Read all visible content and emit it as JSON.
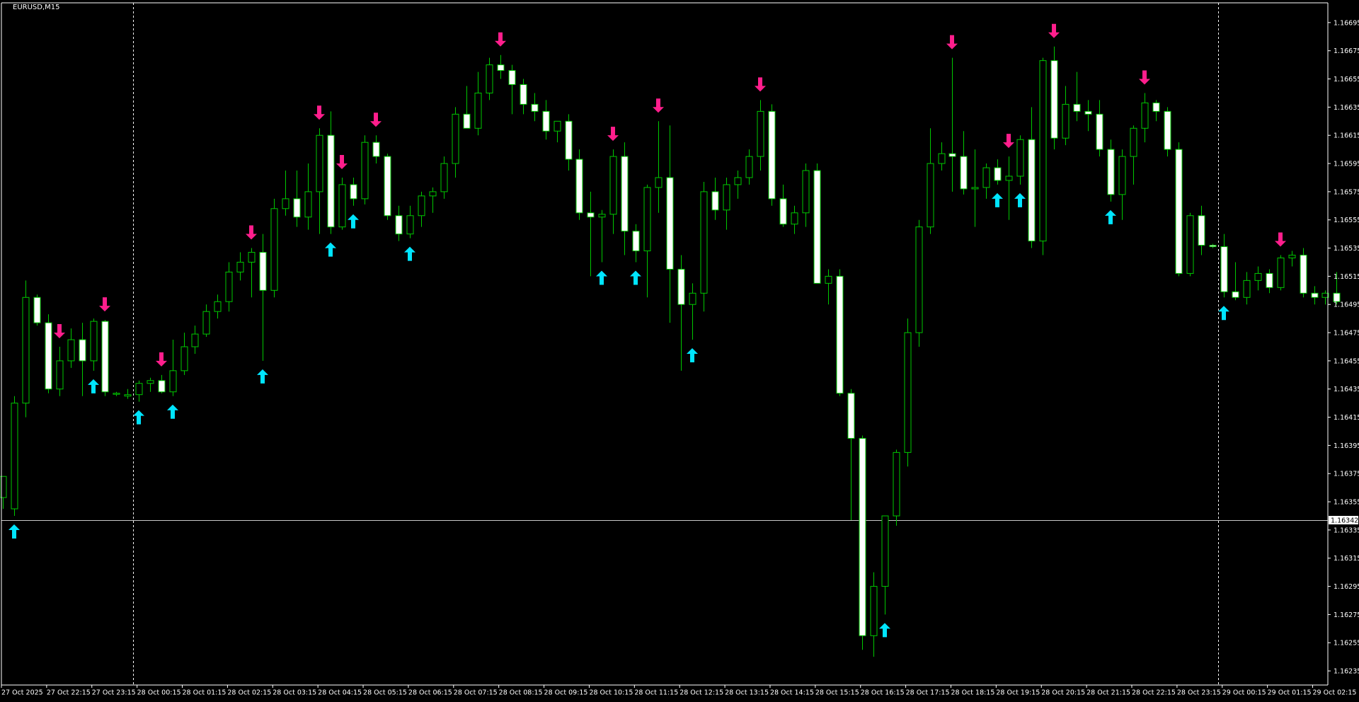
{
  "chart_data": {
    "type": "candlestick",
    "title": "EURUSD,M15",
    "ylim": [
      1.16225,
      1.16709
    ],
    "current_price": 1.16342,
    "current_price_label": "1.16342",
    "y_ticks": [
      "1.16695",
      "1.16675",
      "1.16655",
      "1.16635",
      "1.16615",
      "1.16595",
      "1.16575",
      "1.16555",
      "1.16535",
      "1.16515",
      "1.16495",
      "1.16475",
      "1.16455",
      "1.16435",
      "1.16415",
      "1.16395",
      "1.16375",
      "1.16355",
      "1.16335",
      "1.16315",
      "1.16295",
      "1.16275",
      "1.16255",
      "1.16235"
    ],
    "x_ticks": [
      {
        "label": "27 Oct 2025",
        "bar": 0
      },
      {
        "label": "27 Oct 22:15",
        "bar": 4
      },
      {
        "label": "27 Oct 23:15",
        "bar": 8
      },
      {
        "label": "28 Oct 00:15",
        "bar": 12
      },
      {
        "label": "28 Oct 01:15",
        "bar": 16
      },
      {
        "label": "28 Oct 02:15",
        "bar": 20
      },
      {
        "label": "28 Oct 03:15",
        "bar": 24
      },
      {
        "label": "28 Oct 04:15",
        "bar": 28
      },
      {
        "label": "28 Oct 05:15",
        "bar": 32
      },
      {
        "label": "28 Oct 06:15",
        "bar": 36
      },
      {
        "label": "28 Oct 07:15",
        "bar": 40
      },
      {
        "label": "28 Oct 08:15",
        "bar": 44
      },
      {
        "label": "28 Oct 09:15",
        "bar": 48
      },
      {
        "label": "28 Oct 10:15",
        "bar": 52
      },
      {
        "label": "28 Oct 11:15",
        "bar": 56
      },
      {
        "label": "28 Oct 12:15",
        "bar": 60
      },
      {
        "label": "28 Oct 13:15",
        "bar": 64
      },
      {
        "label": "28 Oct 14:15",
        "bar": 68
      },
      {
        "label": "28 Oct 15:15",
        "bar": 72
      },
      {
        "label": "28 Oct 16:15",
        "bar": 76
      },
      {
        "label": "28 Oct 17:15",
        "bar": 80
      },
      {
        "label": "28 Oct 18:15",
        "bar": 84
      },
      {
        "label": "28 Oct 19:15",
        "bar": 88
      },
      {
        "label": "28 Oct 20:15",
        "bar": 92
      },
      {
        "label": "28 Oct 21:15",
        "bar": 96
      },
      {
        "label": "28 Oct 22:15",
        "bar": 100
      },
      {
        "label": "28 Oct 23:15",
        "bar": 104
      },
      {
        "label": "29 Oct 00:15",
        "bar": 108
      },
      {
        "label": "29 Oct 01:15",
        "bar": 112
      },
      {
        "label": "29 Oct 02:15",
        "bar": 116
      }
    ],
    "day_separators": [
      11,
      107
    ],
    "candles": [
      {
        "o": 1.16358,
        "h": 1.1637,
        "l": 1.1635,
        "c": 1.16373
      },
      {
        "o": 1.1635,
        "h": 1.1643,
        "l": 1.16345,
        "c": 1.16425
      },
      {
        "o": 1.16425,
        "h": 1.16512,
        "l": 1.16415,
        "c": 1.165
      },
      {
        "o": 1.165,
        "h": 1.16502,
        "l": 1.1648,
        "c": 1.16482
      },
      {
        "o": 1.16482,
        "h": 1.16488,
        "l": 1.16432,
        "c": 1.16435
      },
      {
        "o": 1.16435,
        "h": 1.16465,
        "l": 1.1643,
        "c": 1.16455
      },
      {
        "o": 1.16455,
        "h": 1.16478,
        "l": 1.1645,
        "c": 1.1647
      },
      {
        "o": 1.1647,
        "h": 1.16482,
        "l": 1.1643,
        "c": 1.16455
      },
      {
        "o": 1.16455,
        "h": 1.16485,
        "l": 1.16448,
        "c": 1.16483
      },
      {
        "o": 1.16483,
        "h": 1.16484,
        "l": 1.1643,
        "c": 1.16433
      },
      {
        "o": 1.16432,
        "h": 1.16433,
        "l": 1.1643,
        "c": 1.16432
      },
      {
        "o": 1.1643,
        "h": 1.16435,
        "l": 1.16428,
        "c": 1.16431
      },
      {
        "o": 1.16431,
        "h": 1.16441,
        "l": 1.16426,
        "c": 1.16439
      },
      {
        "o": 1.16439,
        "h": 1.16443,
        "l": 1.16433,
        "c": 1.16441
      },
      {
        "o": 1.16441,
        "h": 1.16445,
        "l": 1.16432,
        "c": 1.16433
      },
      {
        "o": 1.16433,
        "h": 1.1647,
        "l": 1.1643,
        "c": 1.16448
      },
      {
        "o": 1.16448,
        "h": 1.16475,
        "l": 1.16445,
        "c": 1.16465
      },
      {
        "o": 1.16465,
        "h": 1.1648,
        "l": 1.1646,
        "c": 1.16474
      },
      {
        "o": 1.16474,
        "h": 1.16495,
        "l": 1.16472,
        "c": 1.1649
      },
      {
        "o": 1.1649,
        "h": 1.16502,
        "l": 1.16485,
        "c": 1.16497
      },
      {
        "o": 1.16497,
        "h": 1.16525,
        "l": 1.1649,
        "c": 1.16518
      },
      {
        "o": 1.16518,
        "h": 1.16532,
        "l": 1.16512,
        "c": 1.16525
      },
      {
        "o": 1.16525,
        "h": 1.16535,
        "l": 1.165,
        "c": 1.16532
      },
      {
        "o": 1.16532,
        "h": 1.16545,
        "l": 1.16455,
        "c": 1.16505
      },
      {
        "o": 1.16505,
        "h": 1.1657,
        "l": 1.165,
        "c": 1.16563
      },
      {
        "o": 1.16563,
        "h": 1.1659,
        "l": 1.16558,
        "c": 1.1657
      },
      {
        "o": 1.1657,
        "h": 1.1659,
        "l": 1.1655,
        "c": 1.16557
      },
      {
        "o": 1.16557,
        "h": 1.16595,
        "l": 1.16548,
        "c": 1.16575
      },
      {
        "o": 1.16575,
        "h": 1.1662,
        "l": 1.16545,
        "c": 1.16615
      },
      {
        "o": 1.16615,
        "h": 1.16632,
        "l": 1.16545,
        "c": 1.1655
      },
      {
        "o": 1.1655,
        "h": 1.16585,
        "l": 1.16548,
        "c": 1.1658
      },
      {
        "o": 1.1658,
        "h": 1.16585,
        "l": 1.16565,
        "c": 1.1657
      },
      {
        "o": 1.1657,
        "h": 1.16615,
        "l": 1.16566,
        "c": 1.1661
      },
      {
        "o": 1.1661,
        "h": 1.16615,
        "l": 1.16595,
        "c": 1.166
      },
      {
        "o": 1.166,
        "h": 1.16602,
        "l": 1.16555,
        "c": 1.16558
      },
      {
        "o": 1.16558,
        "h": 1.16565,
        "l": 1.1654,
        "c": 1.16545
      },
      {
        "o": 1.16545,
        "h": 1.16565,
        "l": 1.16542,
        "c": 1.16558
      },
      {
        "o": 1.16558,
        "h": 1.16575,
        "l": 1.1655,
        "c": 1.16572
      },
      {
        "o": 1.16572,
        "h": 1.16578,
        "l": 1.1656,
        "c": 1.16575
      },
      {
        "o": 1.16575,
        "h": 1.166,
        "l": 1.1657,
        "c": 1.16595
      },
      {
        "o": 1.16595,
        "h": 1.16635,
        "l": 1.16585,
        "c": 1.1663
      },
      {
        "o": 1.1663,
        "h": 1.1665,
        "l": 1.1662,
        "c": 1.1662
      },
      {
        "o": 1.1662,
        "h": 1.1666,
        "l": 1.16615,
        "c": 1.16645
      },
      {
        "o": 1.16645,
        "h": 1.1667,
        "l": 1.1664,
        "c": 1.16665
      },
      {
        "o": 1.16665,
        "h": 1.16672,
        "l": 1.16655,
        "c": 1.16661
      },
      {
        "o": 1.16661,
        "h": 1.16665,
        "l": 1.1663,
        "c": 1.16651
      },
      {
        "o": 1.16651,
        "h": 1.16655,
        "l": 1.1663,
        "c": 1.16637
      },
      {
        "o": 1.16637,
        "h": 1.16645,
        "l": 1.16625,
        "c": 1.16632
      },
      {
        "o": 1.16632,
        "h": 1.1664,
        "l": 1.16612,
        "c": 1.16618
      },
      {
        "o": 1.16618,
        "h": 1.16625,
        "l": 1.1661,
        "c": 1.16625
      },
      {
        "o": 1.16625,
        "h": 1.1663,
        "l": 1.1659,
        "c": 1.16598
      },
      {
        "o": 1.16598,
        "h": 1.16605,
        "l": 1.16555,
        "c": 1.1656
      },
      {
        "o": 1.1656,
        "h": 1.16575,
        "l": 1.16515,
        "c": 1.16557
      },
      {
        "o": 1.16557,
        "h": 1.16562,
        "l": 1.16525,
        "c": 1.16559
      },
      {
        "o": 1.16559,
        "h": 1.16605,
        "l": 1.16545,
        "c": 1.166
      },
      {
        "o": 1.166,
        "h": 1.1661,
        "l": 1.1653,
        "c": 1.16547
      },
      {
        "o": 1.16547,
        "h": 1.16552,
        "l": 1.16525,
        "c": 1.16533
      },
      {
        "o": 1.16533,
        "h": 1.1658,
        "l": 1.165,
        "c": 1.16578
      },
      {
        "o": 1.16578,
        "h": 1.16625,
        "l": 1.1656,
        "c": 1.16585
      },
      {
        "o": 1.16585,
        "h": 1.16622,
        "l": 1.16482,
        "c": 1.1652
      },
      {
        "o": 1.1652,
        "h": 1.1653,
        "l": 1.16448,
        "c": 1.16495
      },
      {
        "o": 1.16495,
        "h": 1.1651,
        "l": 1.1647,
        "c": 1.16503
      },
      {
        "o": 1.16503,
        "h": 1.16582,
        "l": 1.1649,
        "c": 1.16575
      },
      {
        "o": 1.16575,
        "h": 1.16585,
        "l": 1.16555,
        "c": 1.16562
      },
      {
        "o": 1.16562,
        "h": 1.16585,
        "l": 1.16548,
        "c": 1.1658
      },
      {
        "o": 1.1658,
        "h": 1.1659,
        "l": 1.1657,
        "c": 1.16585
      },
      {
        "o": 1.16585,
        "h": 1.16605,
        "l": 1.1658,
        "c": 1.166
      },
      {
        "o": 1.166,
        "h": 1.1664,
        "l": 1.1659,
        "c": 1.16632
      },
      {
        "o": 1.16632,
        "h": 1.16637,
        "l": 1.16565,
        "c": 1.1657
      },
      {
        "o": 1.1657,
        "h": 1.1658,
        "l": 1.1655,
        "c": 1.16552
      },
      {
        "o": 1.16552,
        "h": 1.16565,
        "l": 1.16545,
        "c": 1.1656
      },
      {
        "o": 1.1656,
        "h": 1.16595,
        "l": 1.1655,
        "c": 1.1659
      },
      {
        "o": 1.1659,
        "h": 1.16595,
        "l": 1.1651,
        "c": 1.1651
      },
      {
        "o": 1.1651,
        "h": 1.1652,
        "l": 1.16495,
        "c": 1.16515
      },
      {
        "o": 1.16515,
        "h": 1.1652,
        "l": 1.1643,
        "c": 1.16432
      },
      {
        "o": 1.16432,
        "h": 1.16435,
        "l": 1.16342,
        "c": 1.164
      },
      {
        "o": 1.164,
        "h": 1.16402,
        "l": 1.1625,
        "c": 1.1626
      },
      {
        "o": 1.1626,
        "h": 1.16305,
        "l": 1.16245,
        "c": 1.16295
      },
      {
        "o": 1.16295,
        "h": 1.16345,
        "l": 1.16275,
        "c": 1.16345
      },
      {
        "o": 1.16345,
        "h": 1.16392,
        "l": 1.16338,
        "c": 1.1639
      },
      {
        "o": 1.1639,
        "h": 1.16485,
        "l": 1.1638,
        "c": 1.16475
      },
      {
        "o": 1.16475,
        "h": 1.16555,
        "l": 1.16465,
        "c": 1.1655
      },
      {
        "o": 1.1655,
        "h": 1.1662,
        "l": 1.16545,
        "c": 1.16595
      },
      {
        "o": 1.16595,
        "h": 1.1661,
        "l": 1.1659,
        "c": 1.16602
      },
      {
        "o": 1.16602,
        "h": 1.1667,
        "l": 1.16575,
        "c": 1.166
      },
      {
        "o": 1.166,
        "h": 1.16618,
        "l": 1.16573,
        "c": 1.16577
      },
      {
        "o": 1.16577,
        "h": 1.16605,
        "l": 1.1655,
        "c": 1.16578
      },
      {
        "o": 1.16578,
        "h": 1.16595,
        "l": 1.1657,
        "c": 1.16592
      },
      {
        "o": 1.16592,
        "h": 1.16598,
        "l": 1.1658,
        "c": 1.16583
      },
      {
        "o": 1.16583,
        "h": 1.166,
        "l": 1.16555,
        "c": 1.16586
      },
      {
        "o": 1.16586,
        "h": 1.16615,
        "l": 1.1658,
        "c": 1.16612
      },
      {
        "o": 1.16612,
        "h": 1.16635,
        "l": 1.16535,
        "c": 1.1654
      },
      {
        "o": 1.1654,
        "h": 1.1667,
        "l": 1.1653,
        "c": 1.16668
      },
      {
        "o": 1.16668,
        "h": 1.16678,
        "l": 1.16605,
        "c": 1.16613
      },
      {
        "o": 1.16613,
        "h": 1.1665,
        "l": 1.16608,
        "c": 1.16637
      },
      {
        "o": 1.16637,
        "h": 1.1666,
        "l": 1.16625,
        "c": 1.16632
      },
      {
        "o": 1.16632,
        "h": 1.1664,
        "l": 1.16618,
        "c": 1.1663
      },
      {
        "o": 1.1663,
        "h": 1.1664,
        "l": 1.166,
        "c": 1.16605
      },
      {
        "o": 1.16605,
        "h": 1.16612,
        "l": 1.16568,
        "c": 1.16573
      },
      {
        "o": 1.16573,
        "h": 1.16605,
        "l": 1.16555,
        "c": 1.166
      },
      {
        "o": 1.166,
        "h": 1.16622,
        "l": 1.1658,
        "c": 1.1662
      },
      {
        "o": 1.1662,
        "h": 1.16645,
        "l": 1.1661,
        "c": 1.16638
      },
      {
        "o": 1.16638,
        "h": 1.1664,
        "l": 1.16625,
        "c": 1.16632
      },
      {
        "o": 1.16632,
        "h": 1.16635,
        "l": 1.166,
        "c": 1.16605
      },
      {
        "o": 1.16605,
        "h": 1.1661,
        "l": 1.16515,
        "c": 1.16517
      },
      {
        "o": 1.16517,
        "h": 1.1656,
        "l": 1.16515,
        "c": 1.16558
      },
      {
        "o": 1.16558,
        "h": 1.16565,
        "l": 1.1653,
        "c": 1.16537
      },
      {
        "o": 1.16537,
        "h": 1.16538,
        "l": 1.16535,
        "c": 1.16536
      },
      {
        "o": 1.16536,
        "h": 1.16545,
        "l": 1.165,
        "c": 1.16504
      },
      {
        "o": 1.16504,
        "h": 1.16525,
        "l": 1.16498,
        "c": 1.165
      },
      {
        "o": 1.165,
        "h": 1.16518,
        "l": 1.16495,
        "c": 1.16512
      },
      {
        "o": 1.16512,
        "h": 1.16522,
        "l": 1.16505,
        "c": 1.16517
      },
      {
        "o": 1.16517,
        "h": 1.1652,
        "l": 1.16503,
        "c": 1.16507
      },
      {
        "o": 1.16507,
        "h": 1.1653,
        "l": 1.16505,
        "c": 1.16528
      },
      {
        "o": 1.16528,
        "h": 1.16533,
        "l": 1.16522,
        "c": 1.1653
      },
      {
        "o": 1.1653,
        "h": 1.16535,
        "l": 1.165,
        "c": 1.16503
      },
      {
        "o": 1.16503,
        "h": 1.16508,
        "l": 1.16495,
        "c": 1.165
      },
      {
        "o": 1.165,
        "h": 1.16505,
        "l": 1.16495,
        "c": 1.16503
      },
      {
        "o": 1.16503,
        "h": 1.16518,
        "l": 1.16495,
        "c": 1.16497
      }
    ],
    "buy_signals": [
      1,
      8,
      12,
      15,
      23,
      29,
      31,
      36,
      53,
      56,
      61,
      78,
      88,
      90,
      98,
      108
    ],
    "sell_signals": [
      5,
      9,
      14,
      22,
      28,
      30,
      33,
      44,
      54,
      58,
      67,
      84,
      89,
      93,
      101,
      113
    ],
    "colors": {
      "background": "#000000",
      "bull_fill": "#000000",
      "bull_border": "#00c800",
      "bear_fill": "#ffffff",
      "bear_border": "#00c800",
      "wick": "#00c800",
      "buy_arrow": "#00e5ff",
      "sell_arrow": "#ff1e8c",
      "axis_text": "#ffffff",
      "axis_line": "#ffffff",
      "price_line": "#c8c8c8"
    }
  }
}
